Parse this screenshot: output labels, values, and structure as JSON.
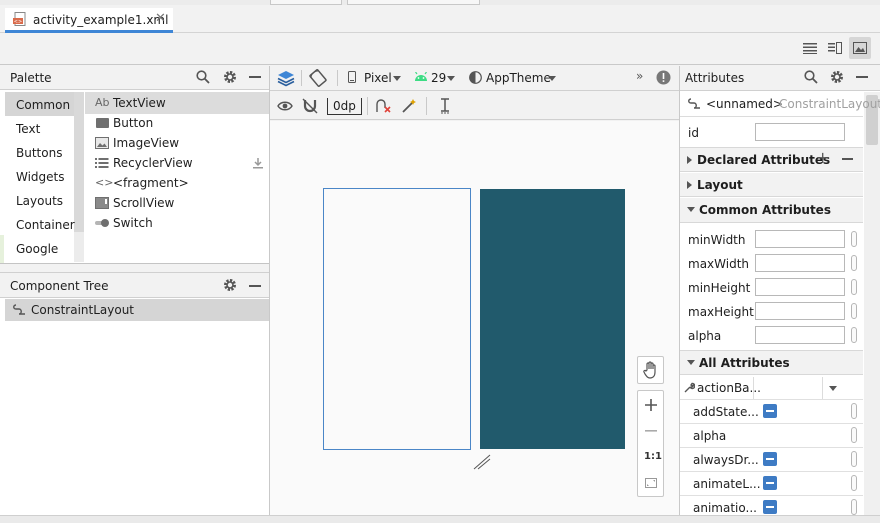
{
  "tab": {
    "filename": "activity_example1.xml"
  },
  "palette": {
    "title": "Palette",
    "categories": [
      "Common",
      "Text",
      "Buttons",
      "Widgets",
      "Layouts",
      "Container",
      "Google"
    ],
    "items": [
      "TextView",
      "Button",
      "ImageView",
      "RecyclerView",
      "<fragment>",
      "ScrollView",
      "Switch"
    ],
    "textview_glyph": "Ab"
  },
  "component_tree": {
    "title": "Component Tree",
    "root": "ConstraintLayout"
  },
  "toolbar": {
    "device": "Pixel",
    "api": "29",
    "theme": "AppTheme",
    "margin": "0dp",
    "overflow": "»"
  },
  "canvas": {
    "blueprint_color": "#215a6c",
    "zoom_fit_label": "1:1"
  },
  "attributes": {
    "title": "Attributes",
    "component": "<unnamed>",
    "component_type": "ConstraintLayout",
    "id_label": "id",
    "declared_header": "Declared Attributes",
    "layout_header": "Layout",
    "common_header": "Common Attributes",
    "common": [
      "minWidth",
      "maxWidth",
      "minHeight",
      "maxHeight",
      "alpha"
    ],
    "all_header": "All Attributes",
    "all": [
      "actionBa...",
      "addState...",
      "alpha",
      "alwaysDr...",
      "animateL...",
      "animatio..."
    ]
  }
}
